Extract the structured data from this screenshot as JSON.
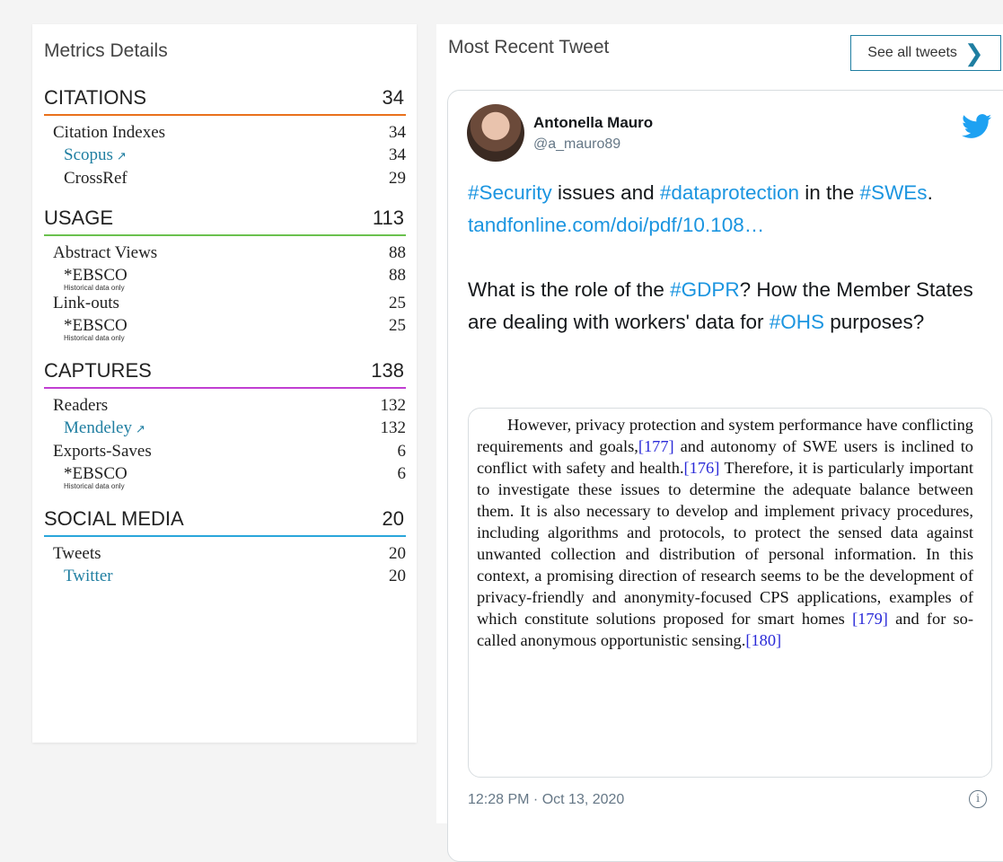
{
  "metrics": {
    "title": "Metrics Details",
    "categories": [
      {
        "name": "CITATIONS",
        "count": "34",
        "color": "#e9711c",
        "rows": [
          {
            "label": "Citation Indexes",
            "value": "34",
            "level": 1
          },
          {
            "label": "Scopus",
            "value": "34",
            "level": 2,
            "link": true
          },
          {
            "label": "CrossRef",
            "value": "29",
            "level": 2
          }
        ]
      },
      {
        "name": "USAGE",
        "count": "113",
        "color": "#6ac14e",
        "rows": [
          {
            "label": "Abstract Views",
            "value": "88",
            "level": 1
          },
          {
            "label": "*EBSCO",
            "value": "88",
            "level": 2,
            "note": "Historical data only"
          },
          {
            "label": "Link-outs",
            "value": "25",
            "level": 1
          },
          {
            "label": "*EBSCO",
            "value": "25",
            "level": 2,
            "note": "Historical data only"
          }
        ]
      },
      {
        "name": "CAPTURES",
        "count": "138",
        "color": "#c13fd2",
        "rows": [
          {
            "label": "Readers",
            "value": "132",
            "level": 1
          },
          {
            "label": "Mendeley",
            "value": "132",
            "level": 2,
            "link": true
          },
          {
            "label": "Exports-Saves",
            "value": "6",
            "level": 1
          },
          {
            "label": "*EBSCO",
            "value": "6",
            "level": 2,
            "note": "Historical data only"
          }
        ]
      },
      {
        "name": "SOCIAL MEDIA",
        "count": "20",
        "color": "#2aa6db",
        "rows": [
          {
            "label": "Tweets",
            "value": "20",
            "level": 1
          },
          {
            "label": "Twitter",
            "value": "20",
            "level": 2,
            "link": true
          }
        ]
      }
    ]
  },
  "tweet_panel": {
    "title": "Most Recent Tweet",
    "see_all_label": "See all tweets",
    "tweet": {
      "author_name": "Antonella Mauro",
      "author_handle": "@a_mauro89",
      "text_parts_line1": [
        {
          "t": "#Security",
          "type": "tag"
        },
        {
          "t": " issues and ",
          "type": "text"
        },
        {
          "t": "#dataprotection",
          "type": "tag"
        },
        {
          "t": " in the ",
          "type": "text"
        },
        {
          "t": "#SWEs",
          "type": "tag"
        },
        {
          "t": ".",
          "type": "text"
        }
      ],
      "link_text": "tandfonline.com/doi/pdf/10.108…",
      "text_parts_line2": [
        {
          "t": "What is the role of the ",
          "type": "text"
        },
        {
          "t": "#GDPR",
          "type": "tag"
        },
        {
          "t": "? How the Member States are dealing with workers' data for ",
          "type": "text"
        },
        {
          "t": "#OHS",
          "type": "tag"
        },
        {
          "t": " purposes?",
          "type": "text"
        }
      ],
      "media_parts": [
        {
          "t": "However, privacy protection and system performance have conflicting requirements and goals,",
          "ref": false
        },
        {
          "t": "[177]",
          "ref": true
        },
        {
          "t": " and autonomy of SWE users is inclined to conflict with safety and health.",
          "ref": false
        },
        {
          "t": "[176]",
          "ref": true
        },
        {
          "t": " Therefore, it is particularly important to investigate these issues to determine the adequate balance between them. It is also necessary to develop and implement privacy procedures, including algorithms and protocols, to protect the sensed data against unwanted collection and distribution of personal information. In this context, a promising direction of research seems to be the development of privacy-friendly and anonymity-focused CPS applications, examples of which constitute solutions proposed for smart homes ",
          "ref": false
        },
        {
          "t": "[179]",
          "ref": true
        },
        {
          "t": " and for so-called anonymous opportunistic sensing.",
          "ref": false
        },
        {
          "t": "[180]",
          "ref": true
        }
      ],
      "timestamp": "12:28 PM · Oct 13, 2020"
    }
  },
  "icons": {
    "external_link": "↗",
    "chevron": "❯",
    "info": "i"
  },
  "colors": {
    "link": "#1f7ea1",
    "twitter_blue": "#1b95e0",
    "twitter_bird": "#1da1f2"
  }
}
